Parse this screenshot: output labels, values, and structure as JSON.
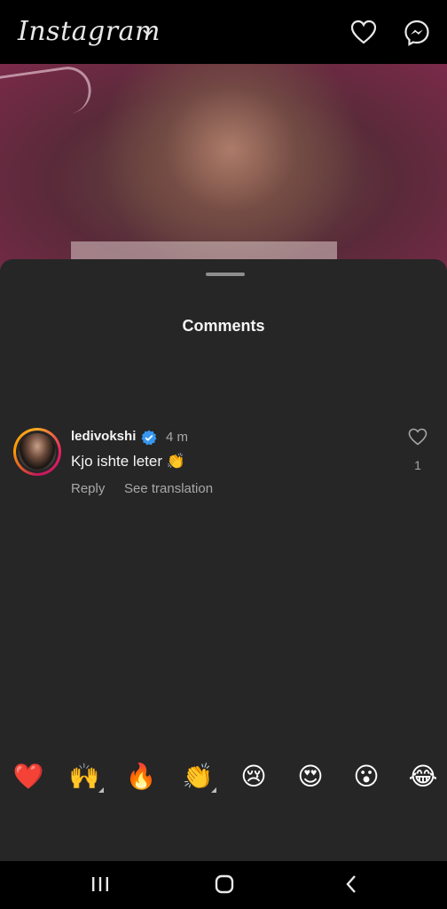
{
  "app": {
    "logo_text": "Instagram",
    "icons": [
      "chevron-down-icon",
      "heart-icon",
      "messenger-icon"
    ]
  },
  "sheet": {
    "title": "Comments"
  },
  "comment": {
    "username": "ledivokshi",
    "verified": true,
    "time": "4 m",
    "text": "Kjo ishte leter 👏",
    "reply_label": "Reply",
    "translate_label": "See translation",
    "like_count": "1"
  },
  "emoji_bar": {
    "emojis": [
      "❤️",
      "🙌",
      "🔥",
      "👏",
      "😢",
      "😍",
      "😮",
      "😂"
    ]
  },
  "navbar": {
    "icons": [
      "recent-apps-icon",
      "home-icon",
      "back-icon"
    ]
  },
  "colors": {
    "sheet_bg": "#262626",
    "verified_blue": "#3897f0",
    "muted_text": "#a8a8a8"
  }
}
